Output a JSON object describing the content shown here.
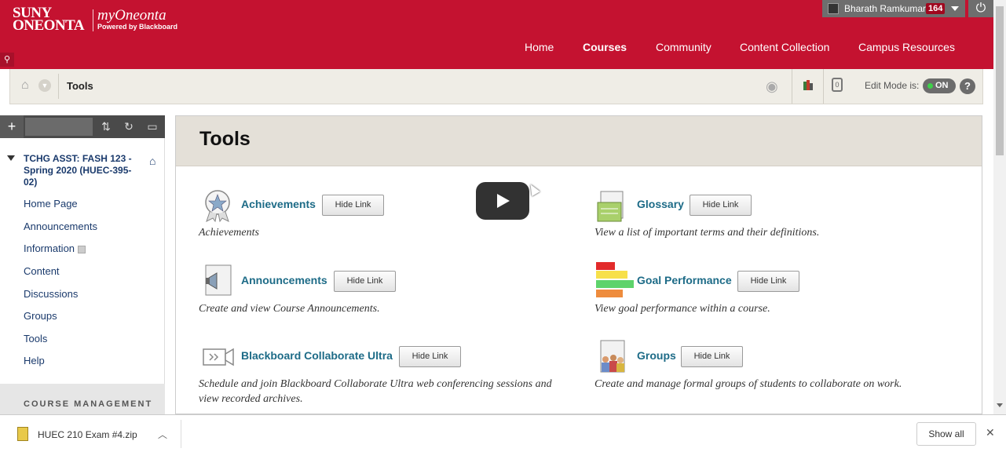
{
  "header": {
    "logo_line1": "SUNY",
    "logo_line2": "ONEONTA",
    "brand": "myOneonta",
    "powered": "Powered by Blackboard",
    "user_name": "Bharath Ramkumar",
    "user_badge": "164",
    "nav": [
      "Home",
      "Courses",
      "Community",
      "Content Collection",
      "Campus Resources"
    ],
    "active_nav": "Courses",
    "colors": {
      "brand_red": "#c41230",
      "userbar": "#6e6e6e"
    }
  },
  "breadcrumb": {
    "title": "Tools",
    "edit_mode_label": "Edit Mode is:",
    "edit_mode_state": "ON",
    "help": "?",
    "lock_count": "0"
  },
  "sidebar": {
    "course_title": "TCHG ASST: FASH 123 - Spring 2020 (HUEC-395-02)",
    "items": [
      "Home Page",
      "Announcements",
      "Information",
      "Content",
      "Discussions",
      "Groups",
      "Tools",
      "Help"
    ],
    "course_management": "COURSE MANAGEMENT"
  },
  "main": {
    "title": "Tools",
    "tools": [
      {
        "name": "Achievements",
        "button": "Hide Link",
        "desc": "Achievements",
        "icon": "achievement-badge-icon"
      },
      {
        "name": "Glossary",
        "button": "Hide Link",
        "desc": "View a list of important terms and their definitions.",
        "icon": "glossary-book-icon"
      },
      {
        "name": "Announcements",
        "button": "Hide Link",
        "desc": "Create and view Course Announcements.",
        "icon": "megaphone-icon"
      },
      {
        "name": "Goal Performance",
        "button": "Hide Link",
        "desc": "View goal performance within a course.",
        "icon": "bar-chart-icon"
      },
      {
        "name": "Blackboard Collaborate Ultra",
        "button": "Hide Link",
        "desc": "Schedule and join Blackboard Collaborate Ultra web conferencing sessions and view recorded archives.",
        "icon": "video-camera-icon"
      },
      {
        "name": "Groups",
        "button": "Hide Link",
        "desc": "Create and manage formal groups of students to collaborate on work.",
        "icon": "people-group-icon"
      }
    ]
  },
  "download": {
    "file": "HUEC 210 Exam #4.zip",
    "show_all": "Show all",
    "close": "✕"
  }
}
